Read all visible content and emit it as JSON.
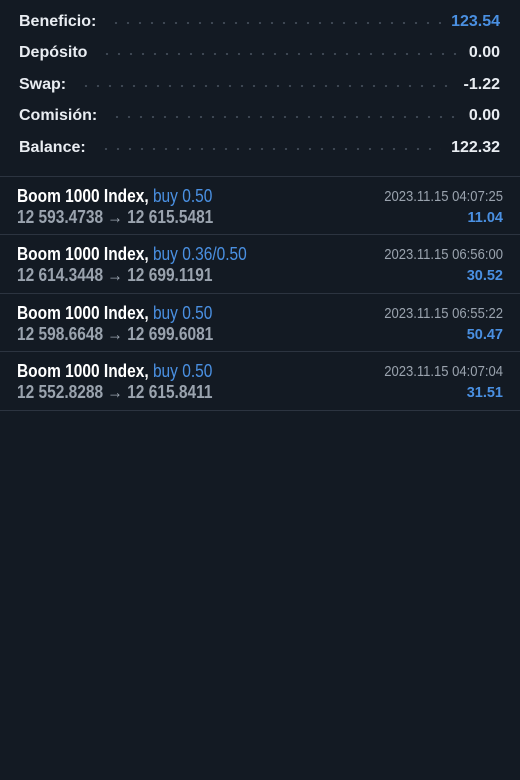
{
  "summary": {
    "rows": [
      {
        "label": "Beneficio:",
        "value": "123.54"
      },
      {
        "label": "Depósito",
        "value": "0.00"
      },
      {
        "label": "Swap:",
        "value": "-1.22"
      },
      {
        "label": "Comisión:",
        "value": "0.00"
      },
      {
        "label": "Balance:",
        "value": "122.32"
      }
    ]
  },
  "deals": [
    {
      "symbol": "Boom 1000 Index,",
      "side": "buy 0.50",
      "open_price": "12 593.4738",
      "arrow": "→",
      "close_price": "12 615.5481",
      "time": "2023.11.15 04:07:25",
      "profit": "11.04"
    },
    {
      "symbol": "Boom 1000 Index,",
      "side": "buy 0.36/0.50",
      "open_price": "12 614.3448",
      "arrow": "→",
      "close_price": "12 699.1191",
      "time": "2023.11.15 06:56:00",
      "profit": "30.52"
    },
    {
      "symbol": "Boom 1000 Index,",
      "side": "buy 0.50",
      "open_price": "12 598.6648",
      "arrow": "→",
      "close_price": "12 699.6081",
      "time": "2023.11.15 06:55:22",
      "profit": "50.47"
    },
    {
      "symbol": "Boom 1000 Index,",
      "side": "buy 0.50",
      "open_price": "12 552.8288",
      "arrow": "→",
      "close_price": "12 615.8411",
      "time": "2023.11.15 04:07:04",
      "profit": "31.51"
    }
  ],
  "colors": {
    "background": "#131a23",
    "accent": "#4a90e2",
    "text": "#e9edf2",
    "muted": "#9aa3ae",
    "divider": "#2c3440"
  }
}
